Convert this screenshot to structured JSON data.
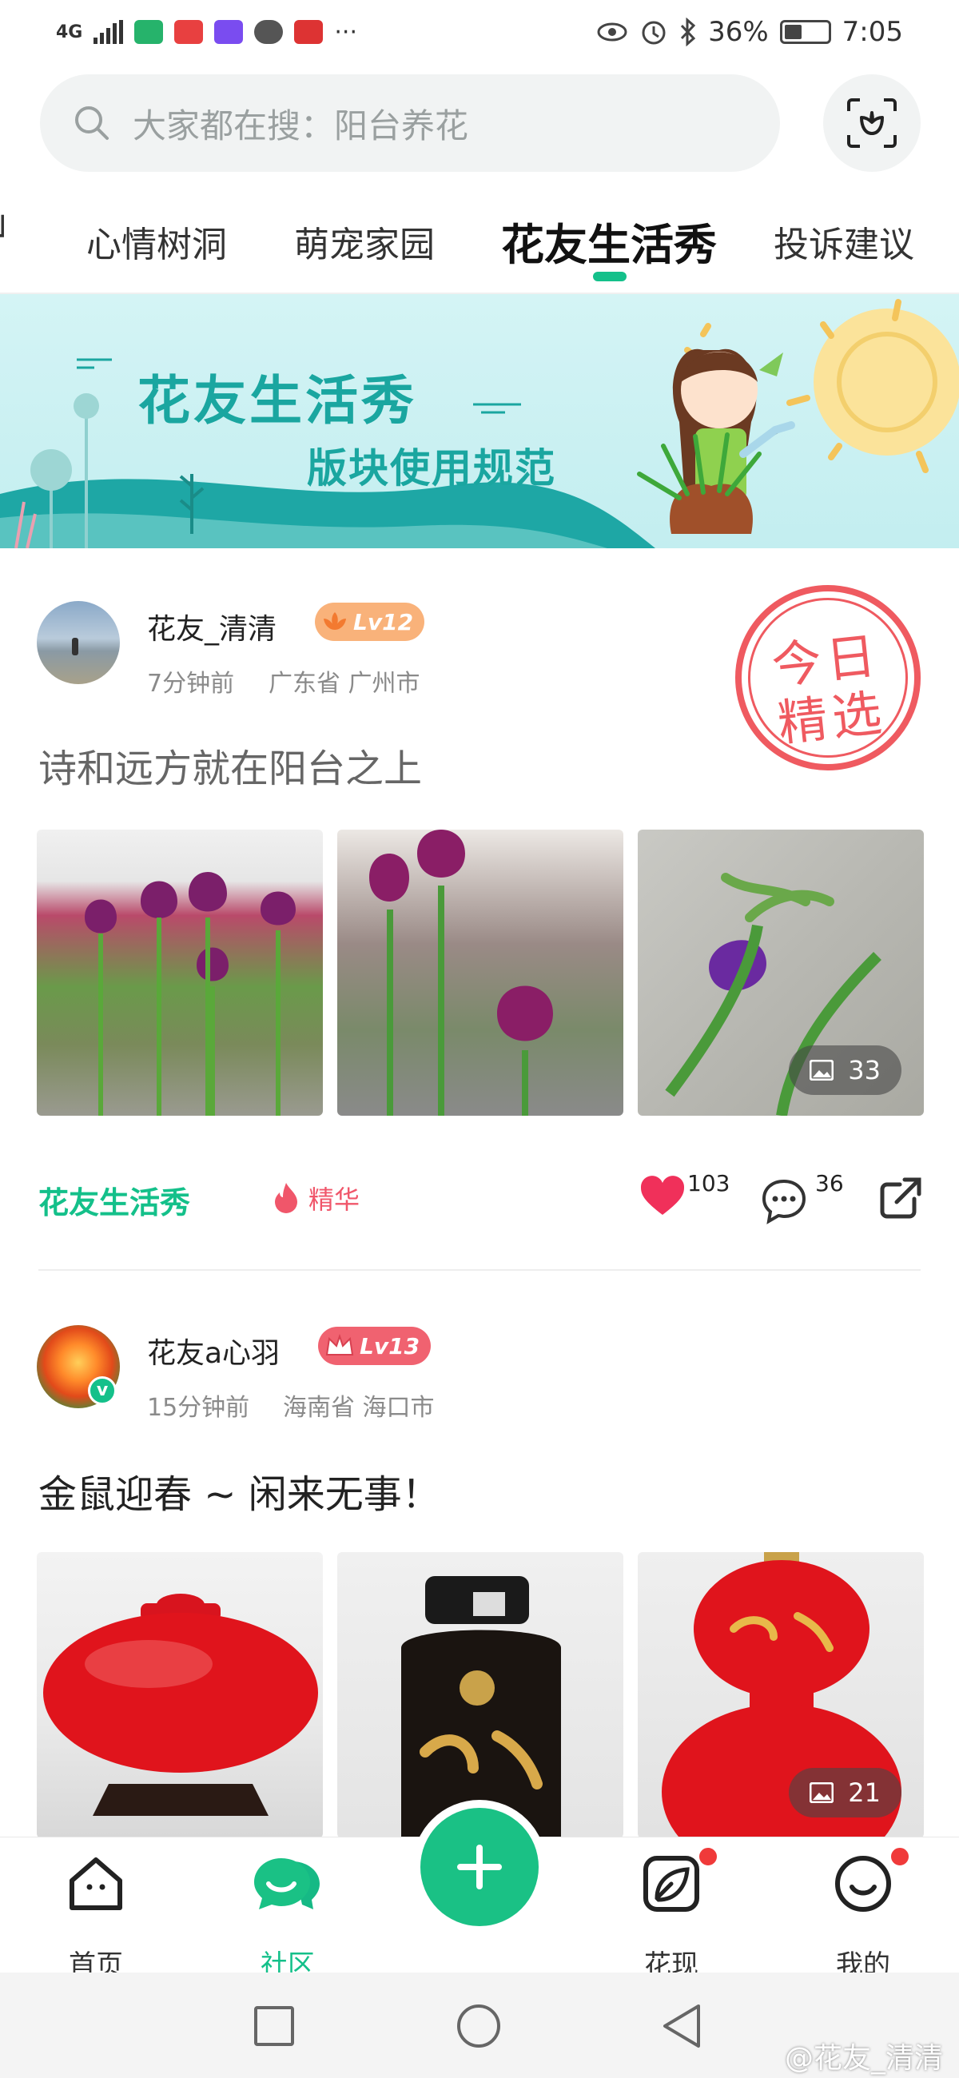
{
  "status_bar": {
    "network": "4G",
    "battery": "36%",
    "time": "7:05",
    "dots": "···"
  },
  "search": {
    "placeholder": "大家都在搜：阳台养花"
  },
  "tabs": [
    {
      "label": "心情树洞"
    },
    {
      "label": "萌宠家园"
    },
    {
      "label": "花友生活秀"
    },
    {
      "label": "投诉建议"
    }
  ],
  "active_tab": "花友生活秀",
  "banner": {
    "title": "花友生活秀",
    "subtitle": "版块使用规范"
  },
  "posts": [
    {
      "username": "花友_清清",
      "level": "Lv12",
      "time": "7分钟前",
      "location": "广东省  广州市",
      "stamp": "今日精选",
      "stamp_line1": "今日",
      "stamp_line2": "精选",
      "text": "诗和远方就在阳台之上",
      "photo_count": "33",
      "topic": "花友生活秀",
      "tag": "精华",
      "likes": "103",
      "comments": "36"
    },
    {
      "username": "花友a心羽",
      "level": "Lv13",
      "time": "15分钟前",
      "location": "海南省  海口市",
      "text": "金鼠迎春 ~ 闲来无事！",
      "photo_count": "21"
    }
  ],
  "bottom_nav": [
    {
      "label": "首页"
    },
    {
      "label": "社区"
    },
    {
      "label": "花现"
    },
    {
      "label": "我的"
    }
  ],
  "watermark": "@花友_清清",
  "colors": {
    "accent": "#14c08a",
    "like": "#f0305a",
    "badge_orange": "#f9b27a",
    "badge_red": "#f06270",
    "stamp": "#ef5a60"
  }
}
